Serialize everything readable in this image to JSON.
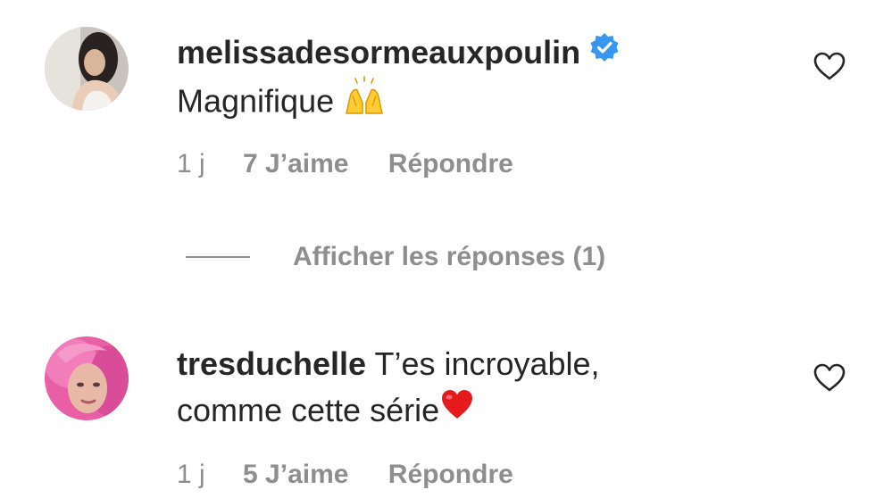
{
  "comments": [
    {
      "username": "melissadesormeauxpoulin",
      "verified": true,
      "text": "Magnifique",
      "emoji": "raising-hands",
      "time": "1 j",
      "likes": "7 J’aime",
      "reply": "Répondre"
    },
    {
      "username": "tresduchelle",
      "verified": false,
      "text_line1": "T’es incroyable,",
      "text_line2": "comme cette série",
      "emoji": "red-heart",
      "time": "1 j",
      "likes": "5 J’aime",
      "reply": "Répondre"
    }
  ],
  "view_replies": {
    "label": "Afficher les réponses (1)"
  },
  "colors": {
    "text": "#262626",
    "secondary": "#8e8e8e",
    "verified_blue": "#3897f0",
    "heart_red": "#e0245e"
  }
}
